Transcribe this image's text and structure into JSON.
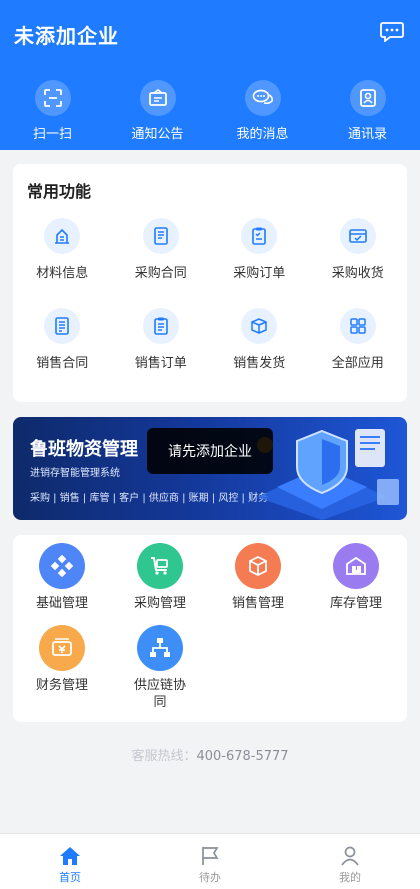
{
  "header": {
    "title": "未添加企业",
    "quick": [
      {
        "label": "扫一扫",
        "icon": "scan-icon"
      },
      {
        "label": "通知公告",
        "icon": "notice-icon"
      },
      {
        "label": "我的消息",
        "icon": "chat-icon"
      },
      {
        "label": "通讯录",
        "icon": "contacts-icon"
      }
    ]
  },
  "common": {
    "title": "常用功能",
    "items": [
      {
        "label": "材料信息",
        "icon": "material-info-icon"
      },
      {
        "label": "采购合同",
        "icon": "purchase-contract-icon"
      },
      {
        "label": "采购订单",
        "icon": "purchase-order-icon"
      },
      {
        "label": "采购收货",
        "icon": "purchase-receive-icon"
      },
      {
        "label": "销售合同",
        "icon": "sales-contract-icon"
      },
      {
        "label": "销售订单",
        "icon": "sales-order-icon"
      },
      {
        "label": "销售发货",
        "icon": "sales-delivery-icon"
      },
      {
        "label": "全部应用",
        "icon": "all-apps-icon"
      }
    ]
  },
  "banner": {
    "title": "鲁班物资管理",
    "subtitle": "进销存智能管理系统",
    "tags": "采购 | 销售 | 库管 | 客户 | 供应商 | 账期 | 风控 | 财务"
  },
  "toast": "请先添加企业",
  "modules": [
    {
      "label": "基础管理",
      "icon": "basic-management-icon",
      "color": "#4f86f7"
    },
    {
      "label": "采购管理",
      "icon": "purchase-management-icon",
      "color": "#2fc78f"
    },
    {
      "label": "销售管理",
      "icon": "sales-management-icon",
      "color": "#f57c52"
    },
    {
      "label": "库存管理",
      "icon": "inventory-management-icon",
      "color": "#9a7cf0"
    },
    {
      "label": "财务管理",
      "icon": "finance-management-icon",
      "color": "#f7a94b"
    },
    {
      "label": "供应链协同",
      "icon": "supply-chain-icon",
      "color": "#3d8ef7"
    }
  ],
  "hotline": {
    "label": "客服热线：",
    "value": "400-678-5777"
  },
  "tabs": [
    {
      "label": "首页",
      "icon": "home-icon",
      "active": true
    },
    {
      "label": "待办",
      "icon": "flag-icon",
      "active": false
    },
    {
      "label": "我的",
      "icon": "user-icon",
      "active": false
    }
  ],
  "colors": {
    "primary": "#1f7bff",
    "background": "#f2f3f5"
  }
}
